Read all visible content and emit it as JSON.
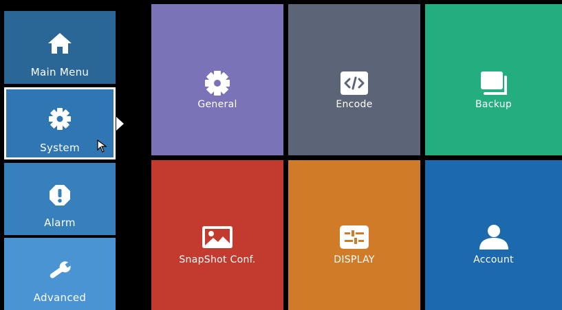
{
  "sidebar": {
    "items": [
      {
        "label": "Main Menu",
        "icon": "home-icon"
      },
      {
        "label": "System",
        "icon": "gear-icon",
        "selected": true
      },
      {
        "label": "Alarm",
        "icon": "alert-icon"
      },
      {
        "label": "Advanced",
        "icon": "wrench-icon"
      }
    ]
  },
  "tiles": [
    {
      "label": "General",
      "icon": "gear-icon",
      "color": "#7a73b8"
    },
    {
      "label": "Encode",
      "icon": "code-icon",
      "color": "#5c6577"
    },
    {
      "label": "Backup",
      "icon": "backup-icon",
      "color": "#24ad7e"
    },
    {
      "label": "SnapShot Conf.",
      "icon": "image-icon",
      "color": "#c33b2f"
    },
    {
      "label": "DISPLAY",
      "icon": "display-settings-icon",
      "color": "#d07b27"
    },
    {
      "label": "Account",
      "icon": "user-icon",
      "color": "#1c69ad"
    }
  ]
}
